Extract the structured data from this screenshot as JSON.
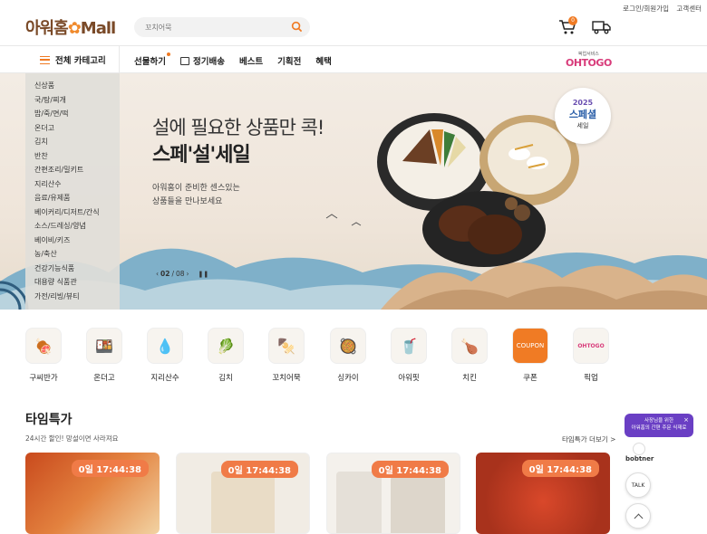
{
  "header": {
    "logo_main": "아워홈",
    "logo_star": "✿",
    "logo_mall": "Mall",
    "search_placeholder": "꼬치어묵",
    "util_login": "로그인/회원가입",
    "util_cs": "고객센터",
    "cart_count": "0"
  },
  "nav": {
    "all_category": "전체 카테고리",
    "menu": [
      "선물하기",
      "정기배송",
      "베스트",
      "기획전",
      "혜택"
    ],
    "ohtogo_small": "픽업서비스",
    "ohtogo": "OHTOGO"
  },
  "sidebar": {
    "categories": [
      "신상품",
      "국/탕/찌개",
      "밥/죽/면/떡",
      "온더고",
      "김치",
      "반찬",
      "간편조리/밀키트",
      "지리산수",
      "음료/유제품",
      "베이커리/디저트/간식",
      "소스/드레싱/양념",
      "베이비/키즈",
      "농/축산",
      "건강기능식품",
      "대용량 식품관",
      "가전/리빙/뷰티"
    ]
  },
  "hero": {
    "headline": "설에 필요한 상품만 콕!",
    "title": "스페'설'세일",
    "sub1": "아워홈이 준비한 센스있는",
    "sub2": "상품들을 만나보세요",
    "page_current": "02",
    "page_sep": "/",
    "page_total": "08",
    "seal_year": "2025",
    "seal_title": "스페셜",
    "seal_sub": "세일"
  },
  "quick_categories": [
    "구씨반가",
    "온더고",
    "지리산수",
    "김치",
    "꼬치어묵",
    "싱카이",
    "아워핏",
    "치킨",
    "쿠폰",
    "픽업"
  ],
  "time_sale": {
    "title": "타임특가",
    "subtitle": "24시간 할인! 망설이면 사라져요",
    "more": "타임특가 더보기 >",
    "timers": [
      "0일 17:44:38",
      "0일 17:44:38",
      "0일 17:44:38",
      "0일 17:44:38"
    ]
  },
  "floating": {
    "bubble_line1": "사장님을 위한",
    "bubble_line2": "아워홈의 간편 주문 식재료",
    "bobtner": "bobtner",
    "talk": "TALK"
  },
  "colors": {
    "accent": "#f07b24",
    "timer": "#f07b47",
    "brand": "#7a4a28"
  }
}
